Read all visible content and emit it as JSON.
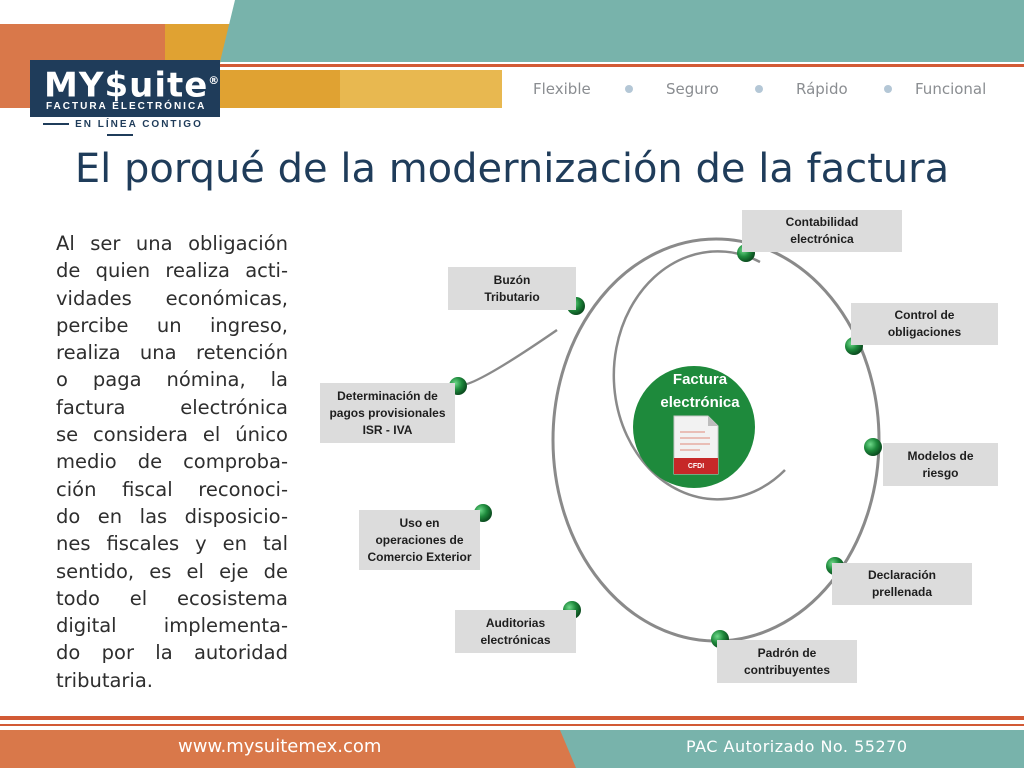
{
  "header": {
    "logo_main": "MY$uite",
    "logo_reg": "®",
    "logo_sub": "FACTURA ELECTRÓNICA",
    "logo_tagline": "EN LÍNEA CONTIGO",
    "tags": [
      "Flexible",
      "Seguro",
      "Rápido",
      "Funcional"
    ],
    "colors": {
      "orange": "#d9784a",
      "gold": "#e0a232",
      "teal": "#78b3ab",
      "navy": "#1f3c5a"
    }
  },
  "title": "El porqué de la modernización de la factura",
  "body_lines": [
    "Al ser una obligación",
    "de quien realiza acti-",
    "vidades económicas,",
    "percibe un ingreso,",
    "realiza una retención",
    "o paga nómina, la",
    "factura electrónica",
    "se considera el único",
    "medio de comproba-",
    "ción fiscal reconoci-",
    "do en las disposicio-",
    "nes fiscales y en tal",
    "sentido, es el eje de",
    "todo el ecosistema",
    "digital implementa-",
    "do por la autoridad",
    "tributaria."
  ],
  "diagram": {
    "center": {
      "lines": [
        "Factura",
        "electrónica"
      ],
      "doc_label": "CFDI",
      "color": "#1e8a3c"
    },
    "nodes": [
      {
        "id": "contabilidad",
        "lines": [
          "Contabilidad",
          "electrónica"
        ]
      },
      {
        "id": "control",
        "lines": [
          "Control de",
          "obligaciones"
        ]
      },
      {
        "id": "modelos",
        "lines": [
          "Modelos de",
          "riesgo"
        ]
      },
      {
        "id": "declaracion",
        "lines": [
          "Declaración",
          "prellenada"
        ]
      },
      {
        "id": "padron",
        "lines": [
          "Padrón de",
          "contribuyentes"
        ]
      },
      {
        "id": "auditorias",
        "lines": [
          "Auditorias",
          "electrónicas"
        ]
      },
      {
        "id": "uso",
        "lines": [
          "Uso en",
          "operaciones de",
          "Comercio Exterior"
        ]
      },
      {
        "id": "determinacion",
        "lines": [
          "Determinación de",
          "pagos provisionales",
          "ISR - IVA"
        ]
      },
      {
        "id": "buzon",
        "lines": [
          "Buzón",
          "Tributario"
        ]
      }
    ]
  },
  "footer": {
    "website": "www.mysuitemex.com",
    "pac": "PAC Autorizado No. 55270"
  }
}
